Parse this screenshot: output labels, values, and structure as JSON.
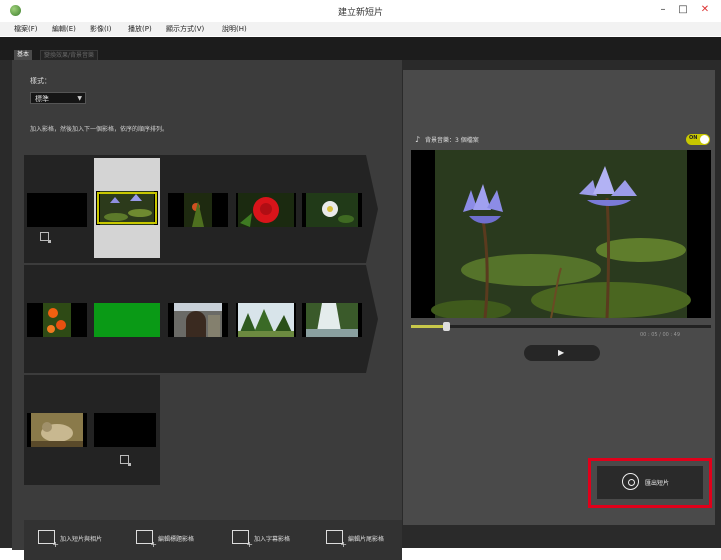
{
  "window": {
    "title": "建立新短片",
    "controls": {
      "minimize": "–",
      "maximize": "□",
      "close": "✕"
    }
  },
  "menu": {
    "items": [
      "檔案(F)",
      "編輯(E)",
      "影像(I)",
      "播放(P)",
      "顯示方式(V)",
      "說明(H)"
    ]
  },
  "tabs": {
    "active": "基本",
    "inactive": "變換效果/背景音樂"
  },
  "editor": {
    "style_label": "樣式：",
    "style_value": "標準",
    "instructions": "加入影格，然後加入下一個影格，依序的順序排列。"
  },
  "toolbar": {
    "add_images": "加入短片與相片",
    "edit_title": "編輯標題影格",
    "add_subtitle": "加入字幕影格",
    "edit_credits": "編輯片尾影格"
  },
  "preview": {
    "music_icon": "♪",
    "music_label": "背景音樂：3 個檔案",
    "toggle_label": "ON",
    "time": "00 : 05 / 00 : 49",
    "play_icon": "▶",
    "progress": 0.12
  },
  "export": {
    "label": "匯出短片"
  },
  "icons": [
    "app-icon",
    "music-note-icon",
    "play-icon",
    "film-reel-icon",
    "add-media-icon",
    "title-icon",
    "subtitle-icon",
    "credits-icon"
  ],
  "colors": {
    "accent": "#c8c800",
    "highlight": "#e0001a",
    "panel": "#3c3c3c",
    "background": "#2a2a2a"
  }
}
